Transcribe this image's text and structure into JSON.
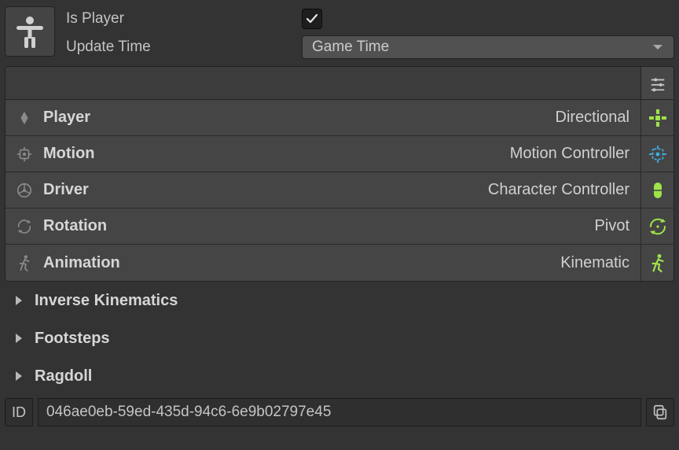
{
  "header": {
    "isPlayerLabel": "Is Player",
    "isPlayerChecked": true,
    "updateTimeLabel": "Update Time",
    "updateTimeValue": "Game Time"
  },
  "sections": [
    {
      "key": "player",
      "label": "Player",
      "value": "Directional"
    },
    {
      "key": "motion",
      "label": "Motion",
      "value": "Motion Controller"
    },
    {
      "key": "driver",
      "label": "Driver",
      "value": "Character Controller"
    },
    {
      "key": "rotation",
      "label": "Rotation",
      "value": "Pivot"
    },
    {
      "key": "animation",
      "label": "Animation",
      "value": "Kinematic"
    }
  ],
  "foldouts": [
    {
      "label": "Inverse Kinematics"
    },
    {
      "label": "Footsteps"
    },
    {
      "label": "Ragdoll"
    }
  ],
  "id": {
    "label": "ID",
    "value": "046ae0eb-59ed-435d-94c6-6e9b02797e45"
  },
  "colors": {
    "accentGreen": "#9fe24a",
    "accentBlue": "#3fb0e0",
    "iconGray": "#8a8a8a"
  }
}
